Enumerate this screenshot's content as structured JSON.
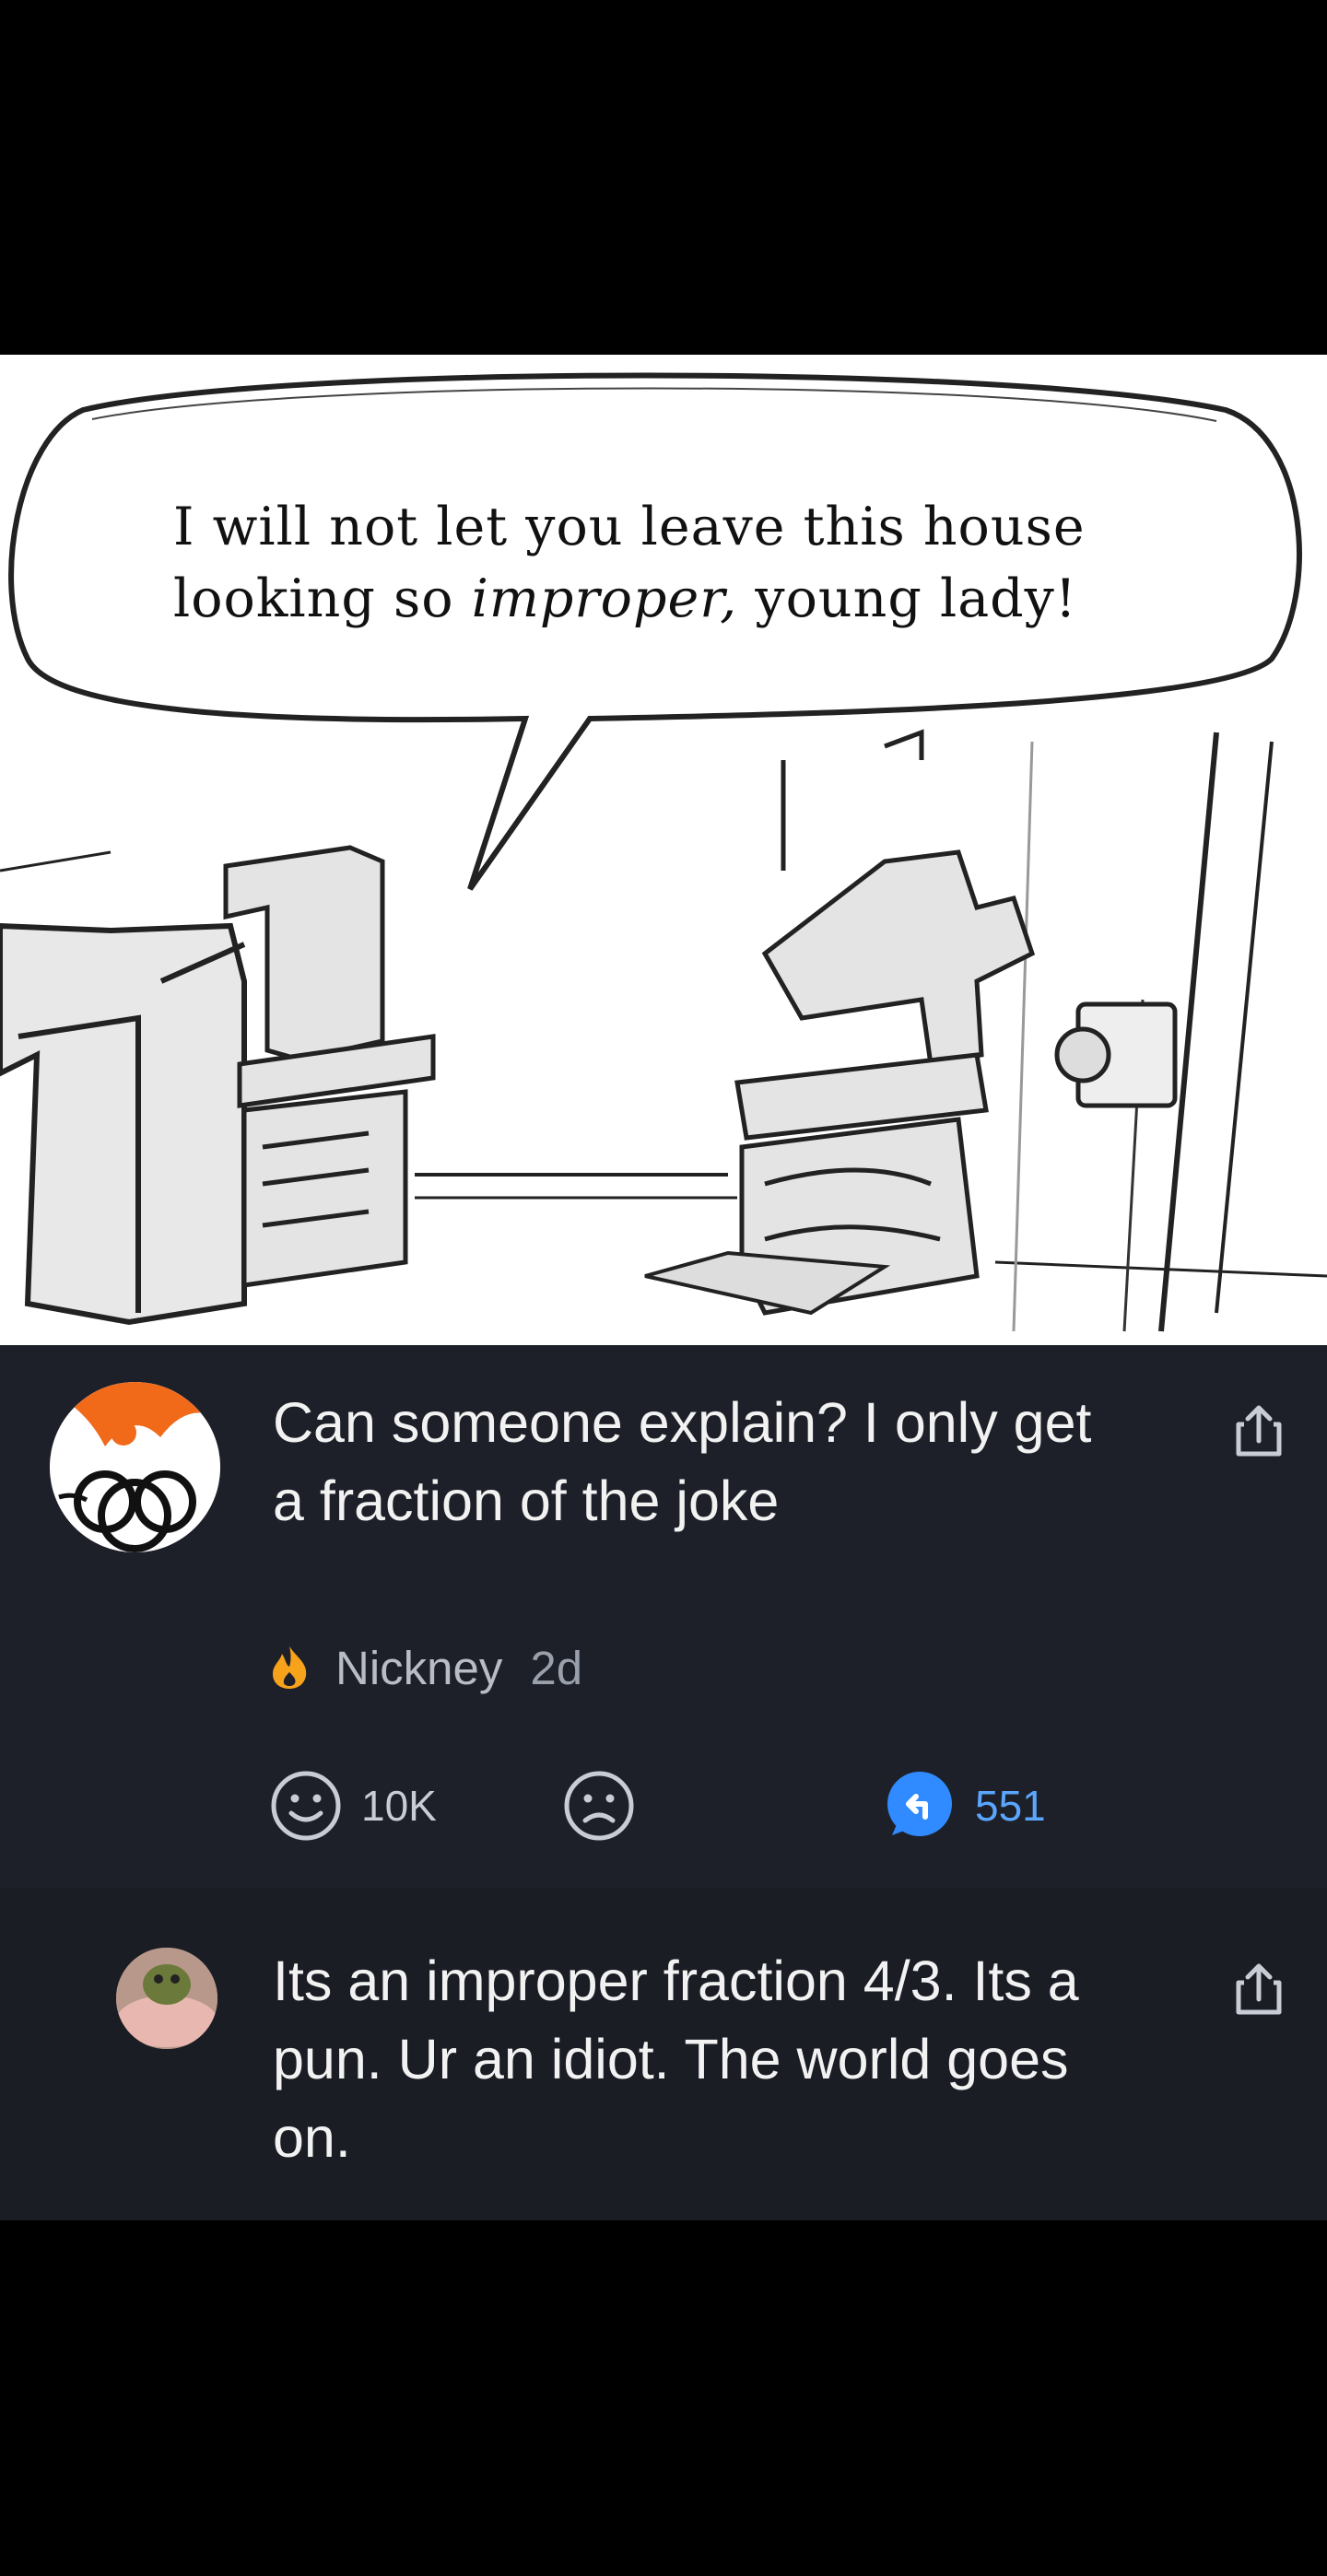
{
  "cartoon": {
    "caption_before": "I will not let you leave this house looking so ",
    "caption_emph": "improper,",
    "caption_after": " young lady!"
  },
  "comments": [
    {
      "text": "Can someone explain? I only get a fraction of the joke",
      "author": "Nickney",
      "age": "2d",
      "likes": "10K",
      "replies": "551"
    },
    {
      "text": "Its an improper fraction 4/3. Its a pun. Ur an idiot. The world goes on."
    }
  ],
  "colors": {
    "background": "#000000",
    "comment_bg": "#1d2028",
    "reply_accent": "#2f8bff",
    "flame": "#f7a21b"
  },
  "icons": [
    "share-icon",
    "smile-icon",
    "frown-icon",
    "reply-icon",
    "flame-icon"
  ]
}
